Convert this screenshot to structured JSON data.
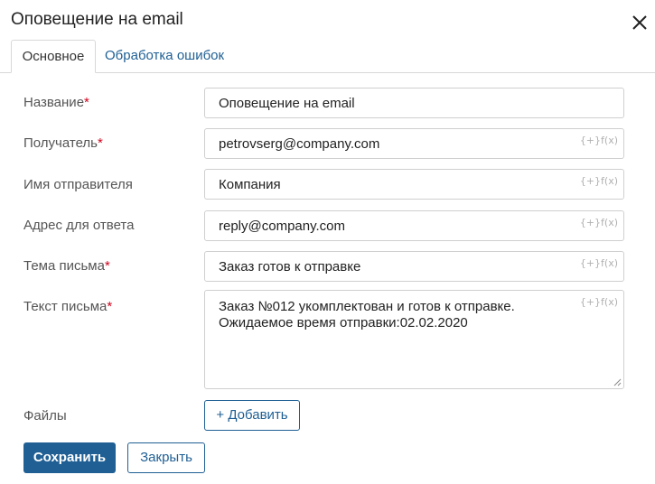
{
  "dialog": {
    "title": "Оповещение на email",
    "close_icon": "close-icon"
  },
  "tabs": [
    {
      "label": "Основное",
      "active": true
    },
    {
      "label": "Обработка ошибок",
      "active": false
    }
  ],
  "form": {
    "required_mark": "*",
    "fx_label": "{+}f(x)",
    "fields": {
      "name": {
        "label": "Название",
        "required": true,
        "value": "Оповещение на email"
      },
      "recipient": {
        "label": "Получатель",
        "required": true,
        "value": "petrovserg@company.com"
      },
      "sender_name": {
        "label": "Имя отправителя",
        "required": false,
        "value": "Компания"
      },
      "reply_to": {
        "label": "Адрес для ответа",
        "required": false,
        "value": "reply@company.com"
      },
      "subject": {
        "label": "Тема письма",
        "required": true,
        "value": "Заказ готов к отправке"
      },
      "body": {
        "label": "Текст письма",
        "required": true,
        "lines": [
          "Заказ №012 укомплектован и готов к отправке.",
          "Ожидаемое время отправки:02.02.2020"
        ]
      },
      "files": {
        "label": "Файлы",
        "add_button": "+ Добавить"
      }
    }
  },
  "footer": {
    "save_button": "Сохранить",
    "close_button": "Закрыть"
  },
  "colors": {
    "accent": "#1f5f94",
    "required": "#d0021b",
    "border": "#cfcfcf"
  }
}
